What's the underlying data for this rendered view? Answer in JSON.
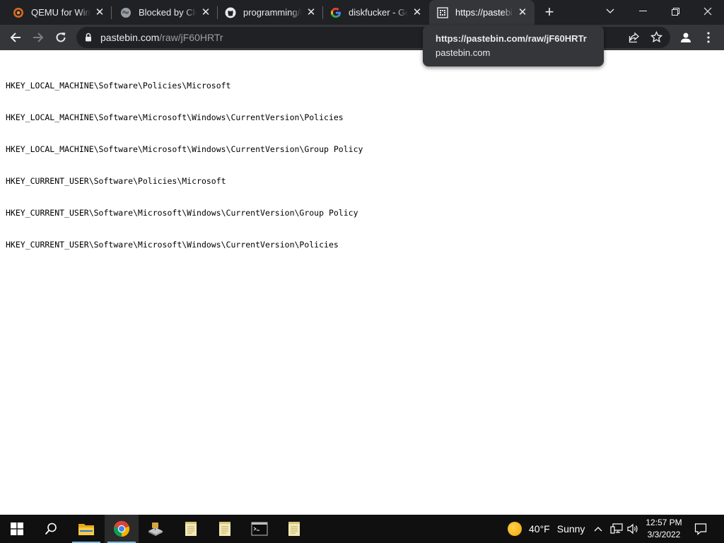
{
  "browser": {
    "tabs": [
      {
        "title": "QEMU for Windows",
        "icon": "qemu-icon"
      },
      {
        "title": "Blocked by Cloudflare",
        "icon": "globe-icon"
      },
      {
        "title": "programming/D",
        "icon": "github-icon"
      },
      {
        "title": "diskfucker - Google",
        "icon": "google-icon"
      },
      {
        "title": "https://pastebin.com",
        "icon": "pastebin-icon",
        "active": true
      }
    ],
    "new_tab_label": "+",
    "address": {
      "domain": "pastebin.com",
      "path": "/raw/jF60HRTr"
    },
    "hover_card": {
      "title": "https://pastebin.com/raw/jF60HRTr",
      "domain": "pastebin.com"
    }
  },
  "page": {
    "lines": [
      "HKEY_LOCAL_MACHINE\\Software\\Policies\\Microsoft",
      "HKEY_LOCAL_MACHINE\\Software\\Microsoft\\Windows\\CurrentVersion\\Policies",
      "HKEY_LOCAL_MACHINE\\Software\\Microsoft\\Windows\\CurrentVersion\\Group Policy",
      "HKEY_CURRENT_USER\\Software\\Policies\\Microsoft",
      "HKEY_CURRENT_USER\\Software\\Microsoft\\Windows\\CurrentVersion\\Group Policy",
      "HKEY_CURRENT_USER\\Software\\Microsoft\\Windows\\CurrentVersion\\Policies"
    ]
  },
  "taskbar": {
    "weather": {
      "temperature": "40°F",
      "condition": "Sunny"
    },
    "clock": {
      "time": "12:57 PM",
      "date": "3/3/2022"
    }
  },
  "colors": {
    "tabstrip": "#202124",
    "toolbar": "#35363a",
    "omnibox": "#202124",
    "taskbar": "#101010",
    "taskbar_accent": "#76b9ed"
  }
}
